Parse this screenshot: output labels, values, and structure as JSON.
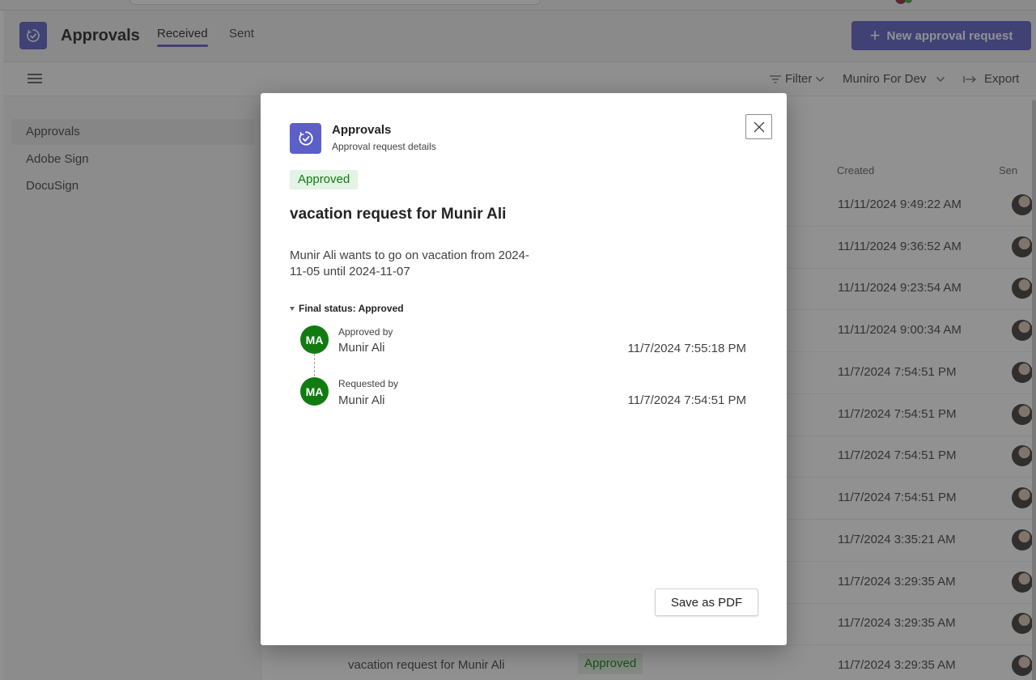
{
  "header": {
    "app_title": "Approvals",
    "tabs": [
      {
        "label": "Received",
        "active": true
      },
      {
        "label": "Sent",
        "active": false
      }
    ],
    "new_button_label": "New approval request",
    "brand_color": "#5b5fc7"
  },
  "toolbar": {
    "filter_label": "Filter",
    "environment_label": "Muniro For Dev",
    "export_label": "Export"
  },
  "sidebar": {
    "items": [
      {
        "label": "Approvals",
        "active": true
      },
      {
        "label": "Adobe Sign",
        "active": false
      },
      {
        "label": "DocuSign",
        "active": false
      }
    ]
  },
  "list": {
    "columns": {
      "created": "Created",
      "sender": "Sen"
    },
    "rows": [
      {
        "created": "11/11/2024 9:49:22 AM"
      },
      {
        "created": "11/11/2024 9:36:52 AM"
      },
      {
        "created": "11/11/2024 9:23:54 AM"
      },
      {
        "created": "11/11/2024 9:00:34 AM"
      },
      {
        "created": "11/7/2024 7:54:51 PM"
      },
      {
        "created": "11/7/2024 7:54:51 PM"
      },
      {
        "created": "11/7/2024 7:54:51 PM"
      },
      {
        "created": "11/7/2024 7:54:51 PM"
      },
      {
        "created": "11/7/2024 3:35:21 AM"
      },
      {
        "created": "11/7/2024 3:29:35 AM"
      },
      {
        "created": "11/7/2024 3:29:35 AM"
      },
      {
        "title": "vacation request for Munir Ali",
        "status": "Approved",
        "created": "11/7/2024 3:29:35 AM"
      }
    ]
  },
  "dialog": {
    "app_name": "Approvals",
    "subtitle": "Approval request details",
    "status": "Approved",
    "title": "vacation request for Munir Ali",
    "description": "Munir Ali wants to go on vacation from 2024-11-05 until 2024-11-07",
    "final_status_label": "Final status: Approved",
    "timeline": [
      {
        "initials": "MA",
        "label": "Approved by",
        "name": "Munir Ali",
        "time": "11/7/2024 7:55:18 PM"
      },
      {
        "initials": "MA",
        "label": "Requested by",
        "name": "Munir Ali",
        "time": "11/7/2024 7:54:51 PM"
      }
    ],
    "save_pdf_label": "Save as PDF",
    "approved_color": "#107c10"
  }
}
